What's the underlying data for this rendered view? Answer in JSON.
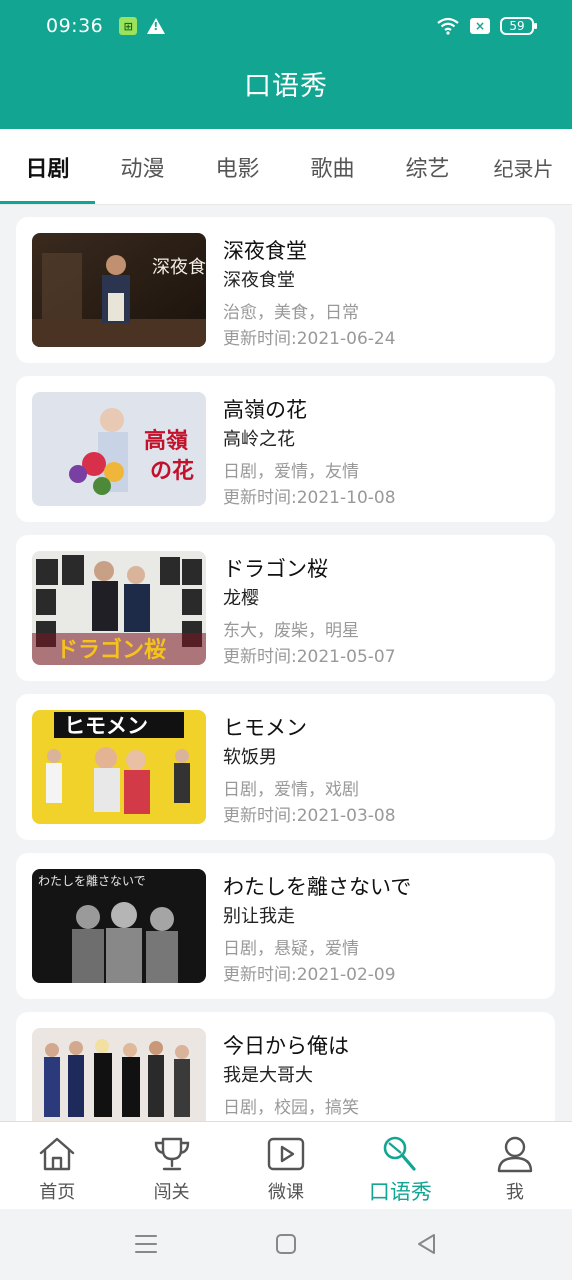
{
  "status_bar": {
    "time": "09:36",
    "battery": "59",
    "notif_badge": "×"
  },
  "header": {
    "title": "口语秀"
  },
  "tabs": [
    {
      "label": "日剧",
      "active": true
    },
    {
      "label": "动漫",
      "active": false
    },
    {
      "label": "电影",
      "active": false
    },
    {
      "label": "歌曲",
      "active": false
    },
    {
      "label": "综艺",
      "active": false
    },
    {
      "label": "纪录片",
      "active": false
    }
  ],
  "cards": [
    {
      "title": "深夜食堂",
      "subtitle": "深夜食堂",
      "tags": "治愈，美食，日常",
      "date": "更新时间:2021-06-24",
      "poster_text": "深夜食堂"
    },
    {
      "title": "高嶺の花",
      "subtitle": "高岭之花",
      "tags": "日剧，爱情，友情",
      "date": "更新时间:2021-10-08",
      "poster_text": "高嶺の花"
    },
    {
      "title": "ドラゴン桜",
      "subtitle": "龙樱",
      "tags": "东大，废柴，明星",
      "date": "更新时间:2021-05-07",
      "poster_text": "ドラゴン桜"
    },
    {
      "title": "ヒモメン",
      "subtitle": "软饭男",
      "tags": "日剧，爱情，戏剧",
      "date": "更新时间:2021-03-08",
      "poster_text": "ヒモメン"
    },
    {
      "title": "わたしを離さないで",
      "subtitle": "别让我走",
      "tags": "日剧，悬疑，爱情",
      "date": "更新时间:2021-02-09",
      "poster_text": "わたしを離さないで"
    },
    {
      "title": "今日から俺は",
      "subtitle": "我是大哥大",
      "tags": "日剧，校园，搞笑",
      "date": "",
      "poster_text": ""
    }
  ],
  "bottom_nav": [
    {
      "label": "首页",
      "icon": "home-icon",
      "active": false
    },
    {
      "label": "闯关",
      "icon": "trophy-icon",
      "active": false
    },
    {
      "label": "微课",
      "icon": "play-icon",
      "active": false
    },
    {
      "label": "口语秀",
      "icon": "microphone-icon",
      "active": true
    },
    {
      "label": "我",
      "icon": "user-icon",
      "active": false
    }
  ],
  "colors": {
    "primary": "#11a592",
    "background": "#f2f3f5"
  }
}
